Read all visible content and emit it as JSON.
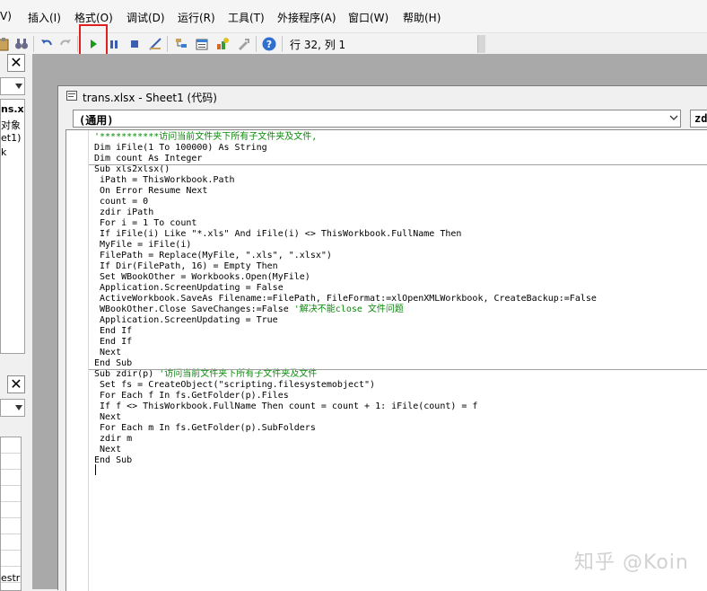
{
  "menu": {
    "items": [
      {
        "name": "menu-view-partial",
        "label": "V)"
      },
      {
        "name": "menu-insert",
        "label": "插入(I)"
      },
      {
        "name": "menu-format",
        "label": "格式(O)"
      },
      {
        "name": "menu-debug",
        "label": "调试(D)"
      },
      {
        "name": "menu-run",
        "label": "运行(R)"
      },
      {
        "name": "menu-tools",
        "label": "工具(T)"
      },
      {
        "name": "menu-addins",
        "label": "外接程序(A)"
      },
      {
        "name": "menu-window",
        "label": "窗口(W)"
      },
      {
        "name": "menu-help",
        "label": "帮助(H)"
      }
    ]
  },
  "toolbar": {
    "position_label": "行 32, 列 1",
    "icons": [
      "paste-icon",
      "find-icon",
      "undo-icon",
      "redo-icon",
      "run-icon",
      "break-icon",
      "reset-icon",
      "design-mode-icon",
      "project-explorer-icon",
      "properties-window-icon",
      "object-browser-icon",
      "toolbox-icon",
      "help-icon"
    ],
    "accent_run": "#1a9a1a",
    "highlight_color": "#e02020"
  },
  "left_panel": {
    "tree_lines": [
      "ns.x",
      "对象",
      "et1)",
      "k"
    ],
    "props_partial": "estr"
  },
  "code_window": {
    "title": "trans.xlsx - Sheet1 (代码)",
    "object_combo": "(通用)",
    "proc_combo": "zdi",
    "lines": [
      {
        "code": "",
        "comment": "'***********访问当前文件夹下所有子文件夹及文件,"
      },
      {
        "code": "Dim iFile(1 To 100000) As String",
        "comment": ""
      },
      {
        "code": "Dim count As Integer",
        "comment": ""
      },
      {
        "code": "Sub xls2xlsx()",
        "comment": ""
      },
      {
        "code": " iPath = ThisWorkbook.Path",
        "comment": ""
      },
      {
        "code": " On Error Resume Next",
        "comment": ""
      },
      {
        "code": " count = 0",
        "comment": ""
      },
      {
        "code": " zdir iPath",
        "comment": ""
      },
      {
        "code": " For i = 1 To count",
        "comment": ""
      },
      {
        "code": " If iFile(i) Like \"*.xls\" And iFile(i) <> ThisWorkbook.FullName Then",
        "comment": ""
      },
      {
        "code": " MyFile = iFile(i)",
        "comment": ""
      },
      {
        "code": " FilePath = Replace(MyFile, \".xls\", \".xlsx\")",
        "comment": ""
      },
      {
        "code": " If Dir(FilePath, 16) = Empty Then",
        "comment": ""
      },
      {
        "code": " Set WBookOther = Workbooks.Open(MyFile)",
        "comment": ""
      },
      {
        "code": " Application.ScreenUpdating = False",
        "comment": ""
      },
      {
        "code": " ActiveWorkbook.SaveAs Filename:=FilePath, FileFormat:=xlOpenXMLWorkbook, CreateBackup:=False",
        "comment": ""
      },
      {
        "code": " WBookOther.Close SaveChanges:=False ",
        "comment": "'解决不能close 文件问题"
      },
      {
        "code": " Application.ScreenUpdating = True",
        "comment": ""
      },
      {
        "code": " End If",
        "comment": ""
      },
      {
        "code": " End If",
        "comment": ""
      },
      {
        "code": " Next",
        "comment": ""
      },
      {
        "code": "End Sub",
        "comment": ""
      },
      {
        "code": "Sub zdir(p) ",
        "comment": "'访问当前文件夹下所有子文件夹及文件"
      },
      {
        "code": " Set fs = CreateObject(\"scripting.filesystemobject\")",
        "comment": ""
      },
      {
        "code": " For Each f In fs.GetFolder(p).Files",
        "comment": ""
      },
      {
        "code": " If f <> ThisWorkbook.FullName Then count = count + 1: iFile(count) = f",
        "comment": ""
      },
      {
        "code": " Next",
        "comment": ""
      },
      {
        "code": " For Each m In fs.GetFolder(p).SubFolders",
        "comment": ""
      },
      {
        "code": " zdir m",
        "comment": ""
      },
      {
        "code": " Next",
        "comment": ""
      },
      {
        "code": "End Sub",
        "comment": ""
      },
      {
        "code": "",
        "comment": ""
      }
    ]
  },
  "watermark": "知乎 @Koin"
}
